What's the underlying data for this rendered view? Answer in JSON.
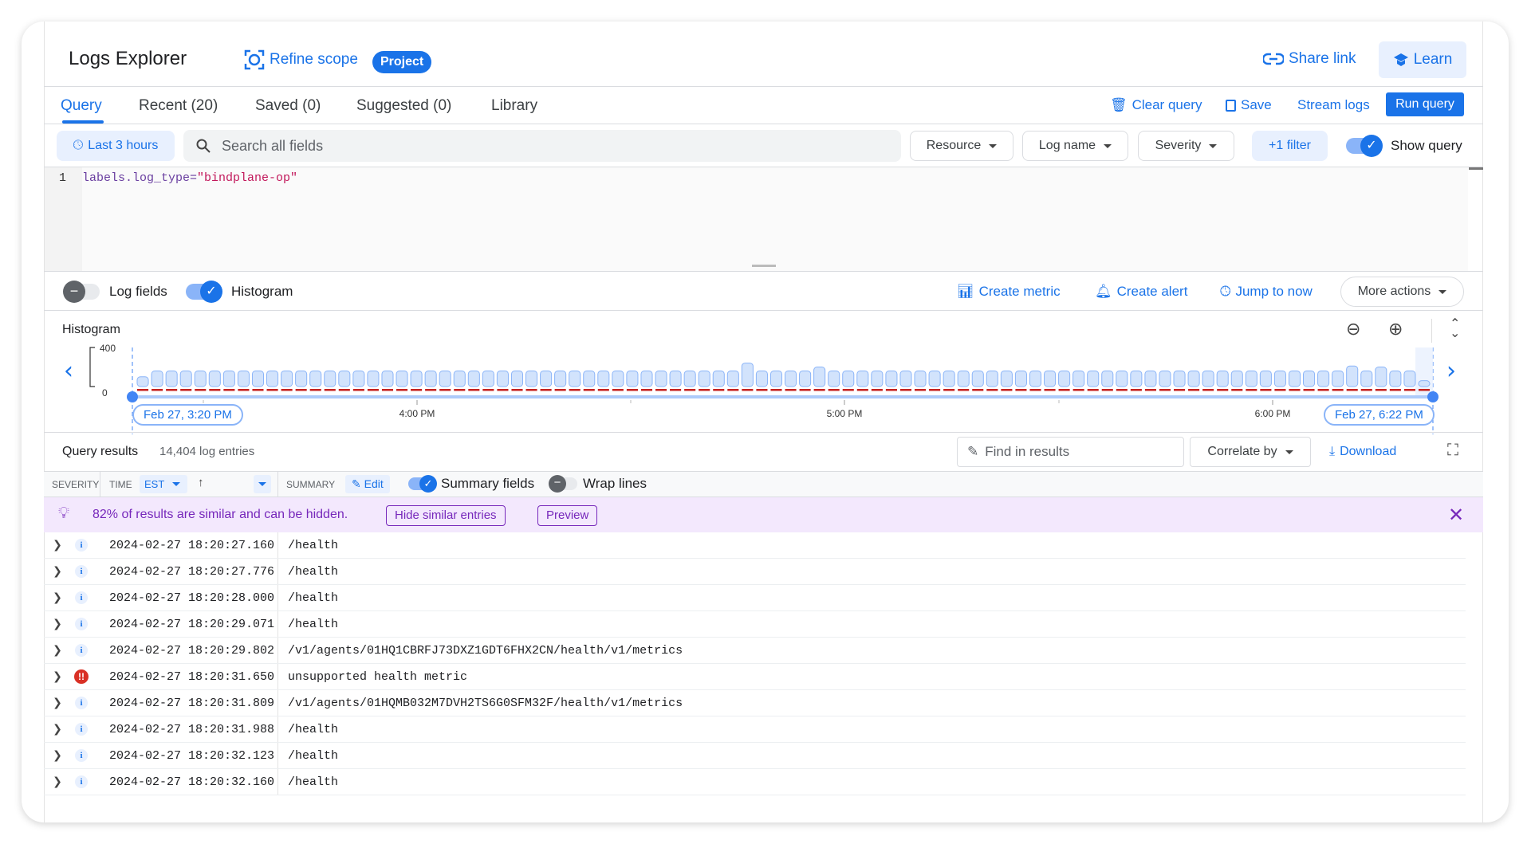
{
  "header": {
    "title": "Logs Explorer",
    "refine_scope": "Refine scope",
    "scope_badge": "Project",
    "share_link": "Share link",
    "learn": "Learn"
  },
  "tabs": [
    {
      "label": "Query",
      "active": true
    },
    {
      "label": "Recent (20)"
    },
    {
      "label": "Saved (0)"
    },
    {
      "label": "Suggested (0)"
    },
    {
      "label": "Library"
    }
  ],
  "actions": {
    "clear_query": "Clear query",
    "save": "Save",
    "stream_logs": "Stream logs",
    "run_query": "Run query"
  },
  "filters": {
    "time_range": "Last 3 hours",
    "search_placeholder": "Search all fields",
    "resource": "Resource",
    "log_name": "Log name",
    "severity": "Severity",
    "add_filter": "+1 filter",
    "show_query": "Show query",
    "show_query_on": true
  },
  "editor": {
    "line_number": "1",
    "query_key": "labels.log_type=",
    "query_value": "\"bindplane-op\""
  },
  "panel_toggles": {
    "log_fields": "Log fields",
    "log_fields_on": false,
    "histogram": "Histogram",
    "histogram_on": true,
    "create_metric": "Create metric",
    "create_alert": "Create alert",
    "jump_to_now": "Jump to now",
    "more_actions": "More actions"
  },
  "histogram": {
    "title": "Histogram",
    "y_max": "400",
    "y_min": "0",
    "start_label": "Feb 27, 3:20 PM",
    "end_label": "Feb 27, 6:22 PM",
    "ticks": [
      "4:00 PM",
      "5:00 PM",
      "6:00 PM"
    ],
    "values": [
      100,
      160,
      160,
      160,
      160,
      160,
      160,
      160,
      160,
      160,
      160,
      160,
      160,
      160,
      160,
      160,
      160,
      160,
      160,
      160,
      160,
      160,
      160,
      160,
      160,
      160,
      160,
      160,
      160,
      160,
      160,
      160,
      160,
      160,
      160,
      160,
      160,
      160,
      160,
      160,
      160,
      160,
      240,
      160,
      160,
      160,
      160,
      200,
      160,
      160,
      160,
      160,
      160,
      160,
      160,
      160,
      160,
      160,
      160,
      160,
      160,
      160,
      160,
      160,
      160,
      160,
      160,
      160,
      160,
      160,
      160,
      160,
      160,
      160,
      160,
      160,
      160,
      160,
      160,
      160,
      160,
      160,
      160,
      160,
      210,
      160,
      200,
      160,
      160,
      60
    ],
    "colors": {
      "bar": "#d2e3fc",
      "bar_stroke": "#8ab4f8",
      "error": "#c5221f"
    }
  },
  "results": {
    "title": "Query results",
    "count": "14,404 log entries",
    "find_placeholder": "Find in results",
    "correlate": "Correlate by",
    "download": "Download",
    "columns": {
      "severity": "SEVERITY",
      "time": "TIME",
      "timezone": "EST",
      "summary": "SUMMARY",
      "edit": "Edit",
      "summary_fields": "Summary fields",
      "wrap_lines": "Wrap lines"
    },
    "banner": {
      "text": "82% of results are similar and can be hidden.",
      "hide": "Hide similar entries",
      "preview": "Preview"
    },
    "rows": [
      {
        "severity": "info",
        "time": "2024-02-27 18:20:27.160",
        "summary": "/health"
      },
      {
        "severity": "info",
        "time": "2024-02-27 18:20:27.776",
        "summary": "/health"
      },
      {
        "severity": "info",
        "time": "2024-02-27 18:20:28.000",
        "summary": "/health"
      },
      {
        "severity": "info",
        "time": "2024-02-27 18:20:29.071",
        "summary": "/health"
      },
      {
        "severity": "info",
        "time": "2024-02-27 18:20:29.802",
        "summary": "/v1/agents/01HQ1CBRFJ73DXZ1GDT6FHX2CN/health/v1/metrics"
      },
      {
        "severity": "error",
        "time": "2024-02-27 18:20:31.650",
        "summary": "unsupported health metric"
      },
      {
        "severity": "info",
        "time": "2024-02-27 18:20:31.809",
        "summary": "/v1/agents/01HQMB032M7DVH2TS6G0SFM32F/health/v1/metrics"
      },
      {
        "severity": "info",
        "time": "2024-02-27 18:20:31.988",
        "summary": "/health"
      },
      {
        "severity": "info",
        "time": "2024-02-27 18:20:32.123",
        "summary": "/health"
      },
      {
        "severity": "info",
        "time": "2024-02-27 18:20:32.160",
        "summary": "/health"
      }
    ]
  },
  "colors": {
    "accent": "#1a73e8",
    "banner_bg": "#f3e8fd",
    "banner_text": "#7627bb",
    "error": "#d93025"
  }
}
